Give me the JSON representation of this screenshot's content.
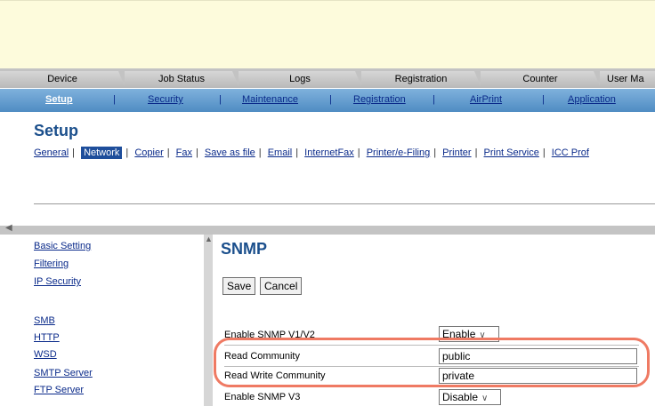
{
  "main_tabs": [
    "Device",
    "Job Status",
    "Logs",
    "Registration",
    "Counter",
    "User Ma"
  ],
  "sub_tabs": [
    "Setup",
    "Security",
    "Maintenance",
    "Registration",
    "AirPrint",
    "Application"
  ],
  "page_title": "Setup",
  "setup_links": [
    "General",
    "Network",
    "Copier",
    "Fax",
    "Save as file",
    "Email",
    "InternetFax",
    "Printer/e-Filing",
    "Printer",
    "Print Service",
    "ICC Prof"
  ],
  "side_nav": [
    "Basic Setting",
    "Filtering",
    "IP Security",
    "SMB",
    "HTTP",
    "WSD",
    "SMTP Server",
    "FTP Server"
  ],
  "section_title": "SNMP",
  "buttons": {
    "save": "Save",
    "cancel": "Cancel"
  },
  "form": {
    "enable_v1v2": {
      "label": "Enable SNMP V1/V2",
      "value": "Enable"
    },
    "read_community": {
      "label": "Read Community",
      "value": "public"
    },
    "read_write_community": {
      "label": "Read Write Community",
      "value": "private"
    },
    "enable_v3": {
      "label": "Enable SNMP V3",
      "value": "Disable"
    }
  },
  "icons": {
    "scroll_left": "◀",
    "scroll_up": "▲",
    "dropdown": "chevron-down-icon"
  },
  "colors": {
    "highlight": "#ef7a63",
    "active_link_bg": "#1e4e9b",
    "title": "#1b4f8c"
  }
}
